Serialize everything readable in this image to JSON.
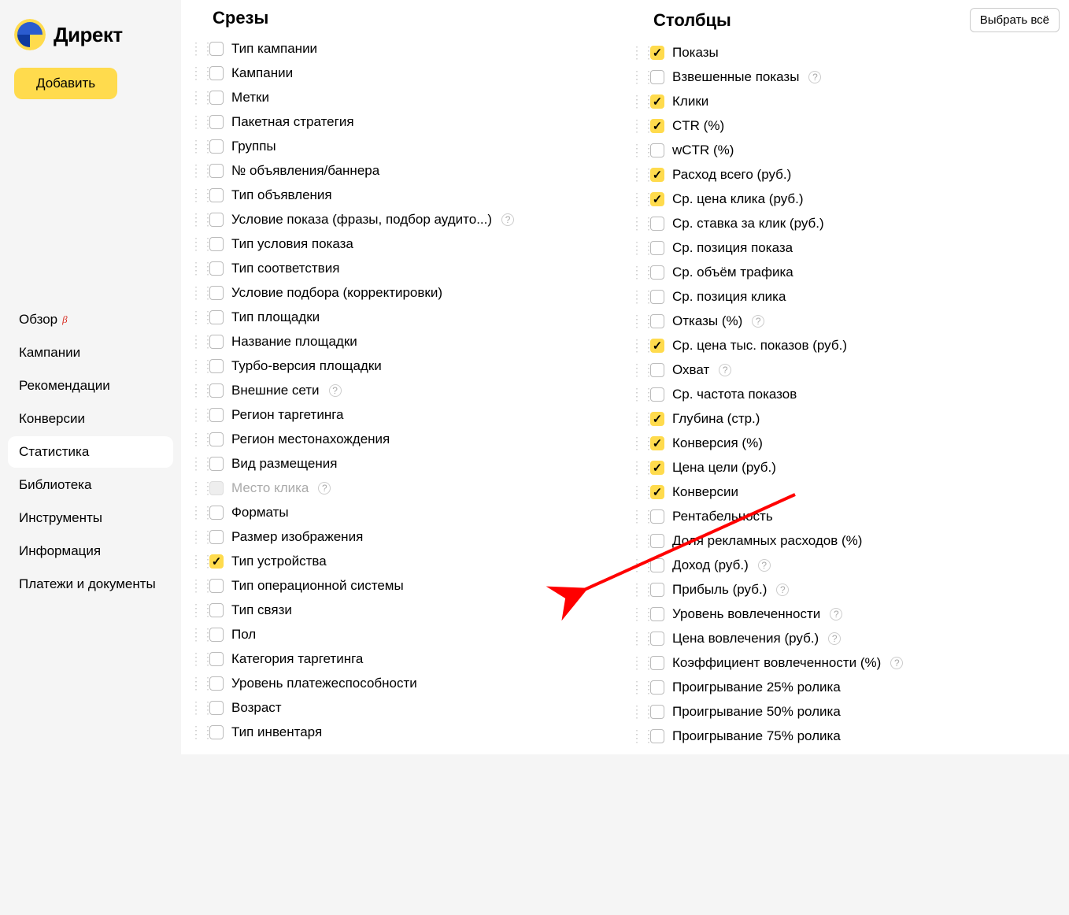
{
  "brand": "Директ",
  "add_button": "Добавить",
  "nav": [
    {
      "label": "Обзор",
      "beta": true,
      "active": false
    },
    {
      "label": "Кампании",
      "beta": false,
      "active": false
    },
    {
      "label": "Рекомендации",
      "beta": false,
      "active": false
    },
    {
      "label": "Конверсии",
      "beta": false,
      "active": false
    },
    {
      "label": "Статистика",
      "beta": false,
      "active": true
    },
    {
      "label": "Библиотека",
      "beta": false,
      "active": false
    },
    {
      "label": "Инструменты",
      "beta": false,
      "active": false
    },
    {
      "label": "Информация",
      "beta": false,
      "active": false
    },
    {
      "label": "Платежи и документы",
      "beta": false,
      "active": false
    }
  ],
  "slices": {
    "title": "Срезы",
    "items": [
      {
        "label": "Тип кампании",
        "checked": false
      },
      {
        "label": "Кампании",
        "checked": false
      },
      {
        "label": "Метки",
        "checked": false
      },
      {
        "label": "Пакетная стратегия",
        "checked": false
      },
      {
        "label": "Группы",
        "checked": false
      },
      {
        "label": "№ объявления/баннера",
        "checked": false
      },
      {
        "label": "Тип объявления",
        "checked": false
      },
      {
        "label": "Условие показа (фразы, подбор аудито...)",
        "checked": false,
        "help": true
      },
      {
        "label": "Тип условия показа",
        "checked": false
      },
      {
        "label": "Тип соответствия",
        "checked": false
      },
      {
        "label": "Условие подбора (корректировки)",
        "checked": false
      },
      {
        "label": "Тип площадки",
        "checked": false
      },
      {
        "label": "Название площадки",
        "checked": false
      },
      {
        "label": "Турбо-версия площадки",
        "checked": false
      },
      {
        "label": "Внешние сети",
        "checked": false,
        "help": true
      },
      {
        "label": "Регион таргетинга",
        "checked": false
      },
      {
        "label": "Регион местонахождения",
        "checked": false
      },
      {
        "label": "Вид размещения",
        "checked": false
      },
      {
        "label": "Место клика",
        "checked": false,
        "disabled": true,
        "help": true
      },
      {
        "label": "Форматы",
        "checked": false
      },
      {
        "label": "Размер изображения",
        "checked": false
      },
      {
        "label": "Тип устройства",
        "checked": true
      },
      {
        "label": "Тип операционной системы",
        "checked": false
      },
      {
        "label": "Тип связи",
        "checked": false
      },
      {
        "label": "Пол",
        "checked": false
      },
      {
        "label": "Категория таргетинга",
        "checked": false
      },
      {
        "label": "Уровень платежеспособности",
        "checked": false
      },
      {
        "label": "Возраст",
        "checked": false
      },
      {
        "label": "Тип инвентаря",
        "checked": false
      }
    ]
  },
  "columns": {
    "title": "Столбцы",
    "select_all": "Выбрать всё",
    "items": [
      {
        "label": "Показы",
        "checked": true
      },
      {
        "label": "Взвешенные показы",
        "checked": false,
        "help": true
      },
      {
        "label": "Клики",
        "checked": true
      },
      {
        "label": "CTR (%)",
        "checked": true
      },
      {
        "label": "wCTR (%)",
        "checked": false
      },
      {
        "label": "Расход всего (руб.)",
        "checked": true
      },
      {
        "label": "Ср. цена клика (руб.)",
        "checked": true
      },
      {
        "label": "Ср. ставка за клик (руб.)",
        "checked": false
      },
      {
        "label": "Ср. позиция показа",
        "checked": false
      },
      {
        "label": "Ср. объём трафика",
        "checked": false
      },
      {
        "label": "Ср. позиция клика",
        "checked": false
      },
      {
        "label": "Отказы (%)",
        "checked": false,
        "help": true
      },
      {
        "label": "Ср. цена тыс. показов (руб.)",
        "checked": true
      },
      {
        "label": "Охват",
        "checked": false,
        "help": true
      },
      {
        "label": "Ср. частота показов",
        "checked": false
      },
      {
        "label": "Глубина (стр.)",
        "checked": true
      },
      {
        "label": "Конверсия (%)",
        "checked": true
      },
      {
        "label": "Цена цели (руб.)",
        "checked": true
      },
      {
        "label": "Конверсии",
        "checked": true
      },
      {
        "label": "Рентабельность",
        "checked": false
      },
      {
        "label": "Доля рекламных расходов (%)",
        "checked": false
      },
      {
        "label": "Доход (руб.)",
        "checked": false,
        "help": true
      },
      {
        "label": "Прибыль (руб.)",
        "checked": false,
        "help": true
      },
      {
        "label": "Уровень вовлеченности",
        "checked": false,
        "help": true
      },
      {
        "label": "Цена вовлечения (руб.)",
        "checked": false,
        "help": true
      },
      {
        "label": "Коэффициент вовлеченности (%)",
        "checked": false,
        "help": true
      },
      {
        "label": "Проигрывание 25% ролика",
        "checked": false
      },
      {
        "label": "Проигрывание 50% ролика",
        "checked": false
      },
      {
        "label": "Проигрывание 75% ролика",
        "checked": false
      }
    ]
  },
  "beta_symbol": "β"
}
